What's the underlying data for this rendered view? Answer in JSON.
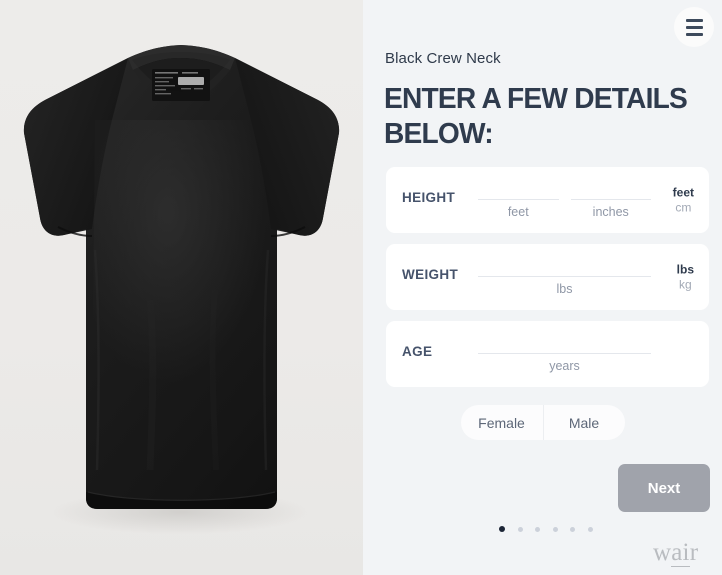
{
  "product": {
    "name": "Black Crew Neck",
    "image_alt": "black crew neck t-shirt"
  },
  "header": {
    "menu_label": "menu",
    "headline": "ENTER A FEW DETAILS BELOW:"
  },
  "form": {
    "height": {
      "label": "HEIGHT",
      "fields": [
        {
          "value": "",
          "placeholder": "",
          "unit": "feet"
        },
        {
          "value": "",
          "placeholder": "",
          "unit": "inches"
        }
      ],
      "unit_toggle": {
        "options": [
          "feet",
          "cm"
        ],
        "selected": "feet"
      }
    },
    "weight": {
      "label": "WEIGHT",
      "fields": [
        {
          "value": "",
          "placeholder": "",
          "unit": "lbs"
        }
      ],
      "unit_toggle": {
        "options": [
          "lbs",
          "kg"
        ],
        "selected": "lbs"
      }
    },
    "age": {
      "label": "AGE",
      "fields": [
        {
          "value": "",
          "placeholder": "",
          "unit": "years"
        }
      ],
      "unit_toggle": null
    },
    "gender": {
      "options": [
        "Female",
        "Male"
      ],
      "selected": null
    },
    "next_label": "Next"
  },
  "pagination": {
    "total": 6,
    "current": 1
  },
  "brand": {
    "text_a": "w",
    "text_b": "ai",
    "text_c": "r"
  },
  "colors": {
    "background": "#f2f4f6",
    "card": "#ffffff",
    "heading": "#2f3b4d",
    "muted": "#8f97a6",
    "next_button": "#a0a3ab",
    "dot_active": "#1c2536",
    "image_background": "#ebeae8"
  }
}
